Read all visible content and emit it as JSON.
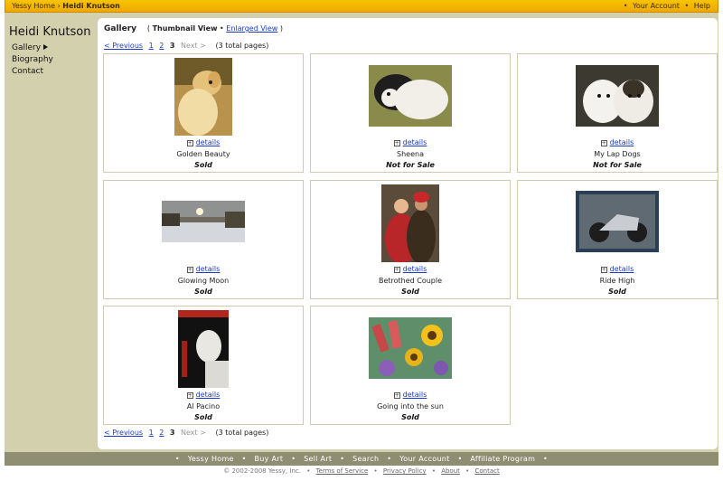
{
  "topbar": {
    "home": "Yessy Home",
    "separator": "›",
    "current": "Heidi Knutson",
    "account": "Your Account",
    "help": "Help",
    "bullet": "•"
  },
  "sidebar": {
    "artist_name": "Heidi Knutson",
    "items": [
      "Gallery",
      "Biography",
      "Contact"
    ]
  },
  "gallery": {
    "title": "Gallery",
    "thumbnail_view": "Thumbnail View",
    "enlarged_view": "Enlarged View",
    "open": "(",
    "close": ")",
    "dot": "•"
  },
  "pager": {
    "previous": "< Previous",
    "pages": [
      "1",
      "2",
      "3"
    ],
    "next": "Next >",
    "total": "(3 total pages)"
  },
  "details_label": "details",
  "artworks": [
    {
      "name": "Golden Beauty",
      "status": "Sold"
    },
    {
      "name": "Sheena",
      "status": "Not for Sale"
    },
    {
      "name": "My Lap Dogs",
      "status": "Not for Sale"
    },
    {
      "name": "Glowing Moon",
      "status": "Sold"
    },
    {
      "name": "Betrothed Couple",
      "status": "Sold"
    },
    {
      "name": "Ride High",
      "status": "Sold"
    },
    {
      "name": "Al Pacino",
      "status": "Sold"
    },
    {
      "name": "Going into the sun",
      "status": "Sold"
    }
  ],
  "footer": {
    "links": [
      "Yessy Home",
      "Buy Art",
      "Sell Art",
      "Search",
      "Your Account",
      "Affiliate Program"
    ],
    "bullet": "•"
  },
  "copyright": {
    "text": "© 2002-2008 Yessy, Inc.",
    "links": [
      "Terms of Service",
      "Privacy Policy",
      "About",
      "Contact"
    ],
    "bullet": "•"
  },
  "colors": {
    "topbar": "#f0b400",
    "sidebar": "#d3d0ad",
    "footer": "#8f8d72",
    "link": "#1b39c8"
  }
}
